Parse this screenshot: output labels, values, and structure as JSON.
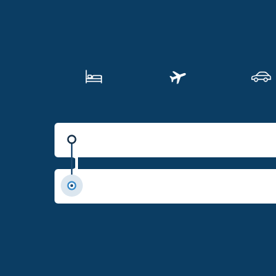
{
  "tabs": [
    {
      "id": "hotels",
      "icon": "bed-icon",
      "active": false
    },
    {
      "id": "flights",
      "icon": "airplane-icon",
      "active": true
    },
    {
      "id": "cars",
      "icon": "car-icon",
      "active": false
    }
  ],
  "search": {
    "origin": {
      "value": "",
      "placeholder": ""
    },
    "destination": {
      "value": "",
      "placeholder": ""
    }
  },
  "colors": {
    "background": "#0b3d63",
    "field": "#ffffff",
    "route_line": "#1f4b73",
    "destination_marker": "#2f86c8",
    "destination_halo": "#dbe6ef",
    "icon": "#ffffff"
  }
}
